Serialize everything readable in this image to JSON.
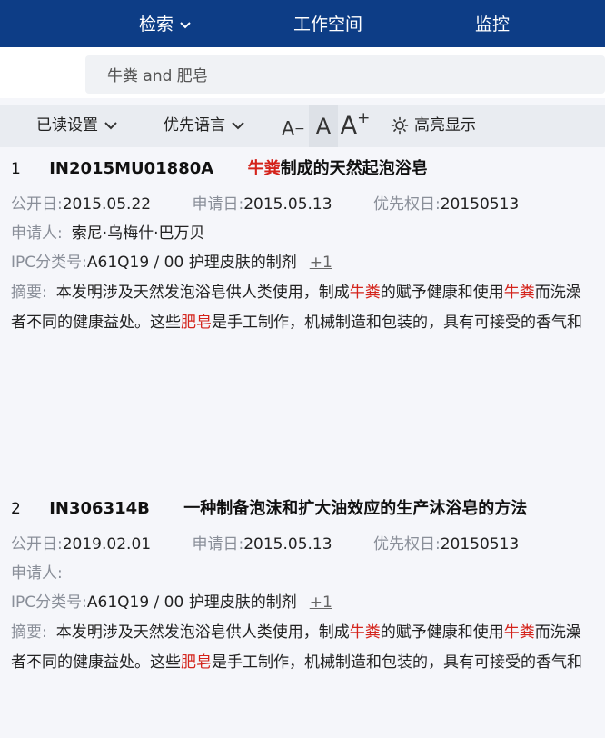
{
  "nav": {
    "search": "检索",
    "workspace": "工作空间",
    "monitor": "监控"
  },
  "search": {
    "value": "牛粪 and 肥皂"
  },
  "toolbar": {
    "read_settings": "已读设置",
    "priority_language": "优先语言",
    "font_smaller": "A",
    "font_smaller_mark": "−",
    "font_default": "A",
    "font_larger": "A",
    "font_larger_mark": "+",
    "highlight": "高亮显示"
  },
  "labels": {
    "pub_date": "公开日:",
    "app_date": "申请日:",
    "priority_date": "优先权日:",
    "applicant": "申请人:",
    "ipc": "IPC分类号:",
    "abstract": "摘要:"
  },
  "colors": {
    "nav_bg": "#0d3d86",
    "highlight": "#d4231b",
    "label": "#8a8f99"
  },
  "results": [
    {
      "index": "1",
      "id": "IN2015MU01880A",
      "title_hl": "牛粪",
      "title_rest": "制成的天然起泡浴皂",
      "pub_date": "2015.05.22",
      "app_date": "2015.05.13",
      "priority_date": "20150513",
      "applicant": "索尼·乌梅什·巴万贝",
      "ipc": "A61Q19 / 00 护理皮肤的制剂",
      "ipc_more": "+1",
      "abstract_1a": "本发明涉及天然发泡浴皂供人类使用，制成",
      "abstract_1b": "牛粪",
      "abstract_1c": "的赋予健康和使用",
      "abstract_1d": "牛粪",
      "abstract_1e": "而洗澡",
      "abstract_2a": "者不同的健康益处。这些",
      "abstract_2b": "肥皂",
      "abstract_2c": "是手工制作，机械制造和包装的，具有可接受的香气和"
    },
    {
      "index": "2",
      "id": "IN306314B",
      "title_hl": "",
      "title_rest": "一种制备泡沫和扩大油效应的生产沐浴皂的方法",
      "pub_date": "2019.02.01",
      "app_date": "2015.05.13",
      "priority_date": "20150513",
      "applicant": "",
      "ipc": "A61Q19 / 00 护理皮肤的制剂",
      "ipc_more": "+1",
      "abstract_1a": "本发明涉及天然发泡浴皂供人类使用，制成",
      "abstract_1b": "牛粪",
      "abstract_1c": "的赋予健康和使用",
      "abstract_1d": "牛粪",
      "abstract_1e": "而洗澡",
      "abstract_2a": "者不同的健康益处。这些",
      "abstract_2b": "肥皂",
      "abstract_2c": "是手工制作，机械制造和包装的，具有可接受的香气和"
    }
  ]
}
